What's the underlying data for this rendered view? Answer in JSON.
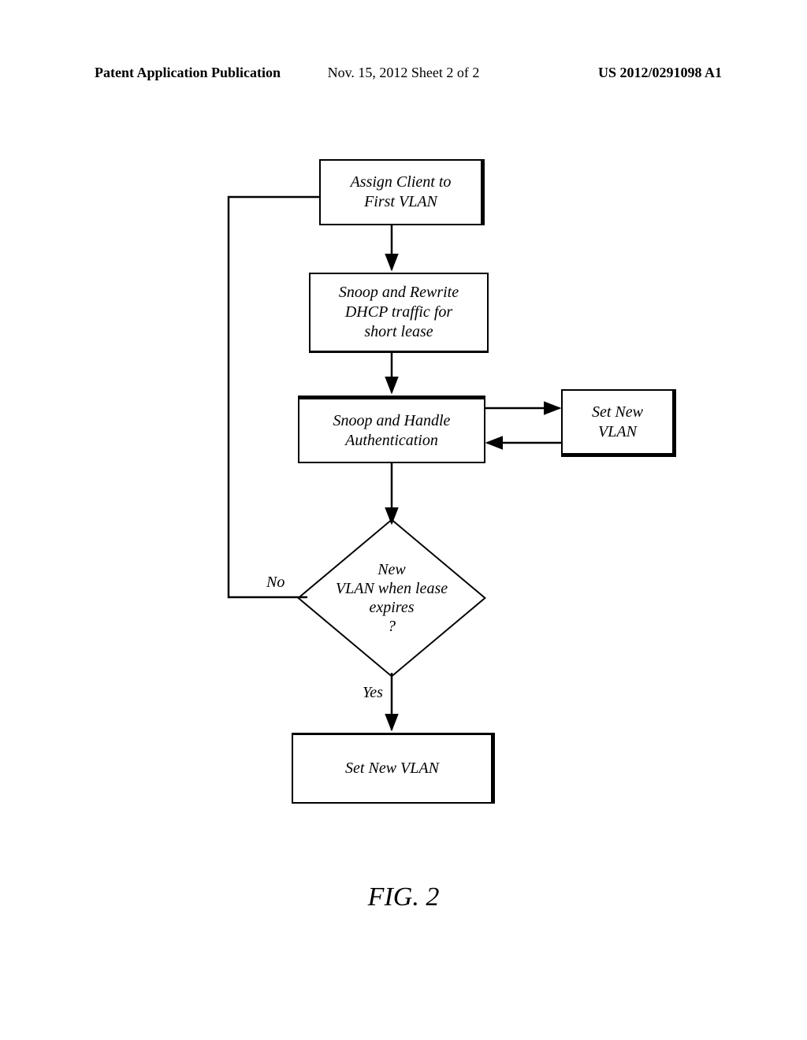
{
  "header": {
    "left": "Patent Application Publication",
    "center": "Nov. 15, 2012  Sheet 2 of 2",
    "right": "US 2012/0291098 A1"
  },
  "flow": {
    "step1": "Assign Client to\nFirst VLAN",
    "step2": "Snoop and Rewrite\nDHCP traffic for\nshort lease",
    "step3": "Snoop and Handle\nAuthentication",
    "side": "Set New\nVLAN",
    "decision": "New\nVLAN when lease\nexpires\n?",
    "no": "No",
    "yes": "Yes",
    "step5": "Set New VLAN"
  },
  "figure_caption": "FIG. 2"
}
